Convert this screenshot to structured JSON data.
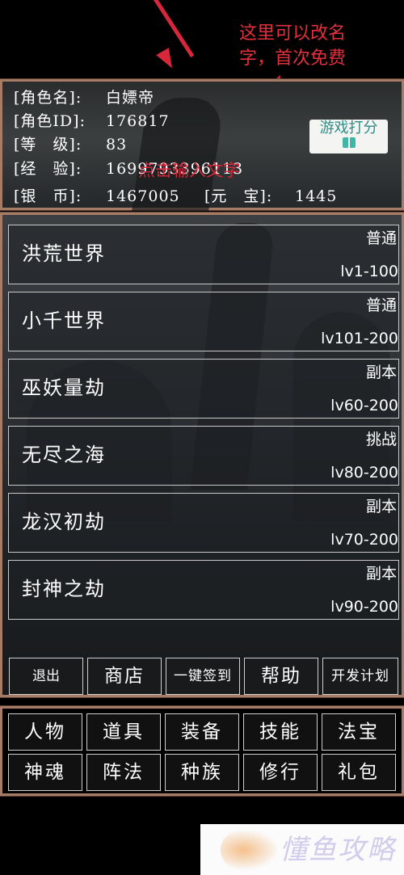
{
  "annotation": {
    "note": "这里可以改名字，首次免费",
    "input_hint": "点击输入文字"
  },
  "player": {
    "name_label": "[角色名]:",
    "name": "白嫖帝",
    "id_label": "[角色ID]:",
    "id": "176817",
    "level_label": "[等　级]:",
    "level": "83",
    "exp_label": "[经　验]:",
    "exp": "1699793396113",
    "silver_label": "[银　币]:",
    "silver": "1467005",
    "yuanbao_label": "[元　宝]:",
    "yuanbao": "1445"
  },
  "rate_button": {
    "label": "游戏打分",
    "icon": "gift-icon"
  },
  "worlds": [
    {
      "name": "洪荒世界",
      "type": "普通",
      "range": "lv1-100"
    },
    {
      "name": "小千世界",
      "type": "普通",
      "range": "lv101-200"
    },
    {
      "name": "巫妖量劫",
      "type": "副本",
      "range": "lv60-200"
    },
    {
      "name": "无尽之海",
      "type": "挑战",
      "range": "lv80-200"
    },
    {
      "name": "龙汉初劫",
      "type": "副本",
      "range": "lv70-200"
    },
    {
      "name": "封神之劫",
      "type": "副本",
      "range": "lv90-200"
    }
  ],
  "actions": {
    "exit": "退出",
    "shop": "商店",
    "checkin": "一键签到",
    "help": "帮助",
    "dev_plan": "开发计划"
  },
  "nav": {
    "row1": [
      "人物",
      "道具",
      "装备",
      "技能",
      "法宝"
    ],
    "row2": [
      "神魂",
      "阵法",
      "种族",
      "修行",
      "礼包"
    ]
  },
  "watermark": {
    "text": "懂鱼攻略"
  },
  "colors": {
    "frame": "#a77c67",
    "annotation": "#e2303c",
    "rate_text": "#2e8d86"
  }
}
